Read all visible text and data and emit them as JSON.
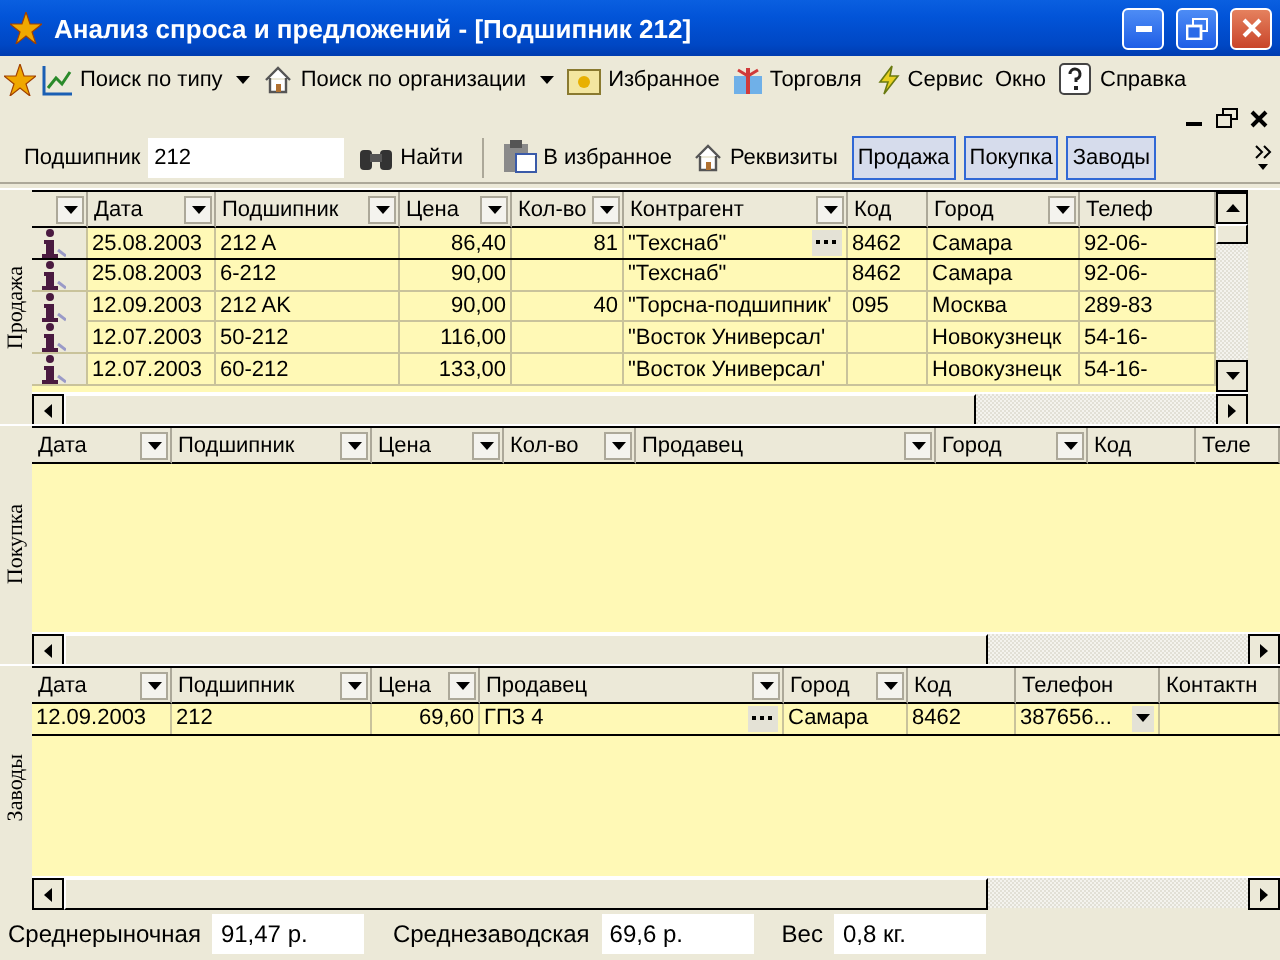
{
  "window": {
    "title": "Анализ спроса и предложений - [Подшипник 212]"
  },
  "menu": [
    {
      "label": "Поиск по типу",
      "dropdown": true
    },
    {
      "label": "Поиск по организации",
      "dropdown": true
    },
    {
      "label": "Избранное",
      "dropdown": false
    },
    {
      "label": "Торговля",
      "dropdown": false
    },
    {
      "label": "Сервис",
      "dropdown": false
    },
    {
      "label": "Окно",
      "dropdown": false
    },
    {
      "label": "Справка",
      "dropdown": false
    }
  ],
  "toolbar": {
    "search_label": "Подшипник",
    "search_value": "212",
    "find_button": "Найти",
    "buttons": [
      "В избранное",
      "Реквизиты"
    ],
    "toggles": [
      {
        "label": "Продажа",
        "on": true
      },
      {
        "label": "Покупка",
        "on": true
      },
      {
        "label": "Заводы",
        "on": true
      }
    ]
  },
  "panels": [
    {
      "label": "Продажа",
      "indicator": true,
      "columns": [
        {
          "label": "Дата",
          "filter": true,
          "kind": "text"
        },
        {
          "label": "Подшипник",
          "filter": true,
          "kind": "text"
        },
        {
          "label": "Цена",
          "filter": true,
          "kind": "number"
        },
        {
          "label": "Кол-во",
          "filter": true,
          "kind": "number"
        },
        {
          "label": "Контрагент",
          "filter": true,
          "kind": "lookup"
        },
        {
          "label": "Код",
          "filter": false,
          "kind": "text"
        },
        {
          "label": "Город",
          "filter": true,
          "kind": "text"
        },
        {
          "label": "Телеф",
          "filter": false,
          "kind": "text"
        }
      ],
      "rows": [
        {
          "selected": true,
          "cells": [
            "25.08.2003",
            "212 A",
            "86,40",
            "81",
            "\"Техснаб\"",
            "8462",
            "Самара",
            "92-06-"
          ]
        },
        {
          "selected": false,
          "cells": [
            "25.08.2003",
            "6-212",
            "90,00",
            null,
            "\"Техснаб\"",
            "8462",
            "Самара",
            "92-06-"
          ]
        },
        {
          "selected": false,
          "cells": [
            "12.09.2003",
            "212 AK",
            "90,00",
            "40",
            "\"Торсна-подшипник'",
            "095",
            "Москва",
            "289-83"
          ]
        },
        {
          "selected": false,
          "cells": [
            "12.07.2003",
            "50-212",
            "116,00",
            null,
            "\"Восток Универсал'",
            null,
            "Новокузнецк",
            "54-16-"
          ]
        },
        {
          "selected": false,
          "cells": [
            "12.07.2003",
            "60-212",
            "133,00",
            null,
            "\"Восток Универсал'",
            null,
            "Новокузнецк",
            "54-16-"
          ]
        }
      ]
    },
    {
      "label": "Покупка",
      "indicator": false,
      "columns": [
        {
          "label": "Дата",
          "filter": true
        },
        {
          "label": "Подшипник",
          "filter": true
        },
        {
          "label": "Цена",
          "filter": true
        },
        {
          "label": "Кол-во",
          "filter": true
        },
        {
          "label": "Продавец",
          "filter": true
        },
        {
          "label": "Город",
          "filter": true
        },
        {
          "label": "Код",
          "filter": false
        },
        {
          "label": "Теле",
          "filter": false
        }
      ]
    },
    {
      "label": "Заводы",
      "indicator": false,
      "columns": [
        {
          "label": "Дата",
          "filter": true,
          "kind": "text"
        },
        {
          "label": "Подшипник",
          "filter": true,
          "kind": "text"
        },
        {
          "label": "Цена",
          "filter": true,
          "kind": "number"
        },
        {
          "label": "Продавец",
          "filter": true,
          "kind": "lookup"
        },
        {
          "label": "Город",
          "filter": true,
          "kind": "text"
        },
        {
          "label": "Код",
          "filter": false,
          "kind": "text"
        },
        {
          "label": "Телефон",
          "filter": false,
          "kind": "combo"
        },
        {
          "label": "Контактн",
          "filter": false,
          "kind": "text"
        }
      ],
      "rows": [
        {
          "selected": true,
          "cells": [
            "12.09.2003",
            "212",
            "69,60",
            "ГПЗ 4",
            "Самара",
            "8462",
            "387656...",
            null
          ]
        }
      ]
    }
  ],
  "status_bar": [
    {
      "label": "Среднерыночная",
      "value": "91,47 р."
    },
    {
      "label": "Среднезаводская",
      "value": "69,6 р."
    },
    {
      "label": "Вес",
      "value": "0,8 кг."
    }
  ]
}
